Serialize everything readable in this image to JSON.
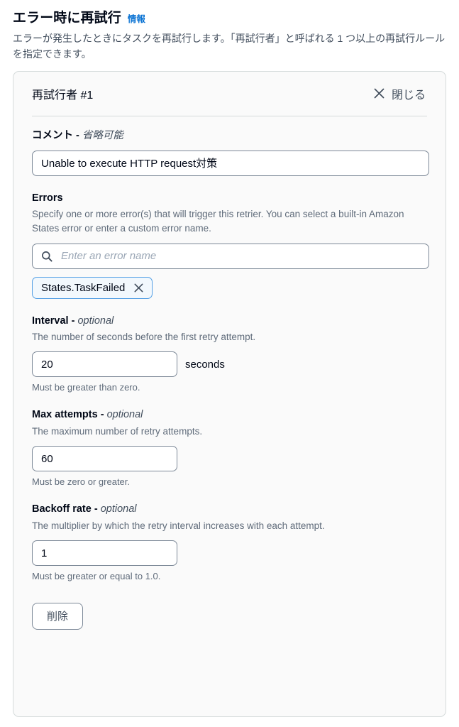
{
  "section": {
    "title": "エラー時に再試行",
    "info_label": "情報",
    "description": "エラーが発生したときにタスクを再試行します。「再試行者」と呼ばれる 1 つ以上の再試行ルールを指定できます。"
  },
  "card": {
    "header_title": "再試行者 #1",
    "close_label": "閉じる",
    "close_icon": "close-x-icon"
  },
  "comment": {
    "label": "コメント - ",
    "optional": "省略可能",
    "value": "Unable to execute HTTP request対策"
  },
  "errors": {
    "label": "Errors",
    "description": "Specify one or more error(s) that will trigger this retrier. You can select a built-in Amazon States error or enter a custom error name.",
    "search_icon": "search-icon",
    "search_placeholder": "Enter an error name",
    "search_value": "",
    "tokens": [
      {
        "label": "States.TaskFailed",
        "remove_icon": "close-x-icon"
      }
    ]
  },
  "interval": {
    "label": "Interval - ",
    "optional": "optional",
    "description": "The number of seconds before the first retry attempt.",
    "value": "20",
    "suffix": "seconds",
    "constraint": "Must be greater than zero."
  },
  "max_attempts": {
    "label": "Max attempts - ",
    "optional": "optional",
    "description": "The maximum number of retry attempts.",
    "value": "60",
    "constraint": "Must be zero or greater."
  },
  "backoff_rate": {
    "label": "Backoff rate - ",
    "optional": "optional",
    "description": "The multiplier by which the retry interval increases with each attempt.",
    "value": "1",
    "constraint": "Must be greater or equal to 1.0."
  },
  "actions": {
    "delete_label": "削除"
  },
  "colors": {
    "link": "#0972d3",
    "token_border": "#539fe5",
    "token_bg": "#f2f8fd",
    "card_bg": "#fafafa",
    "card_border": "#d5dbdb",
    "label_text": "#000716",
    "muted_text": "#5f6b7a",
    "input_border": "#7d8998"
  }
}
